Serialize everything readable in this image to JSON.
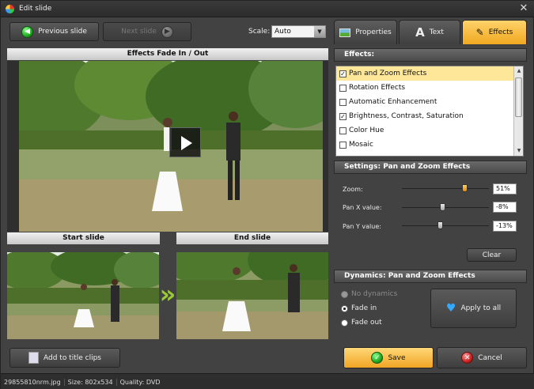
{
  "window": {
    "title": "Edit slide"
  },
  "toolbar": {
    "prev_label": "Previous slide",
    "next_label": "Next slide",
    "scale_label": "Scale:",
    "scale_value": "Auto"
  },
  "preview": {
    "header": "Effects Fade In / Out"
  },
  "slides": {
    "start_label": "Start slide",
    "end_label": "End slide"
  },
  "tabs": [
    {
      "label": "Properties"
    },
    {
      "label": "Text"
    },
    {
      "label": "Effects"
    }
  ],
  "effects": {
    "header": "Effects:",
    "items": [
      {
        "label": "Pan and Zoom Effects",
        "checked": true,
        "selected": true
      },
      {
        "label": "Rotation Effects",
        "checked": false
      },
      {
        "label": "Automatic Enhancement",
        "checked": false
      },
      {
        "label": "Brightness, Contrast, Saturation",
        "checked": true
      },
      {
        "label": "Color Hue",
        "checked": false
      },
      {
        "label": "Mosaic",
        "checked": false
      }
    ]
  },
  "settings": {
    "header": "Settings: Pan and Zoom Effects",
    "zoom_label": "Zoom:",
    "zoom_value": "51%",
    "zoom_level": 0.72,
    "panx_label": "Pan X value:",
    "panx_value": "-8%",
    "panx_level": 0.46,
    "pany_label": "Pan Y value:",
    "pany_value": "-13%",
    "pany_level": 0.44,
    "clear_label": "Clear"
  },
  "dynamics": {
    "header": "Dynamics: Pan and Zoom Effects",
    "options": [
      "No dynamics",
      "Fade in",
      "Fade out"
    ],
    "apply_label": "Apply to all"
  },
  "bottom": {
    "add_title_label": "Add to title clips",
    "save_label": "Save",
    "cancel_label": "Cancel"
  },
  "status": {
    "filename": "29855810nrm.jpg",
    "size": "Size: 802x534",
    "quality": "Quality: DVD"
  }
}
